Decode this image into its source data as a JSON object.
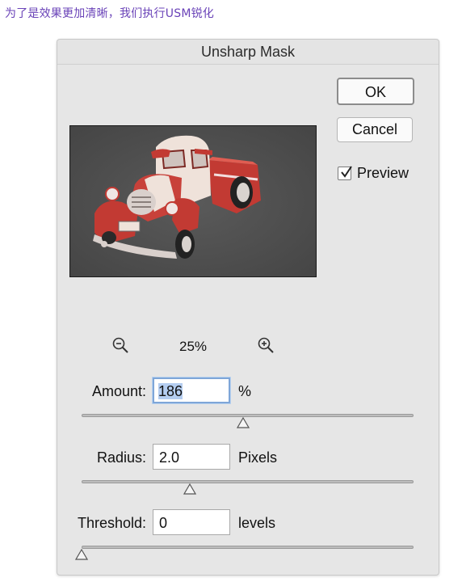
{
  "caption": "为了是效果更加清晰，我们执行USM锐化",
  "dialog": {
    "title": "Unsharp Mask",
    "ok_label": "OK",
    "cancel_label": "Cancel",
    "preview_label": "Preview",
    "preview_checked": true,
    "zoom_level": "25%",
    "amount": {
      "label": "Amount:",
      "value": "186",
      "unit": "%",
      "slider_min": 1,
      "slider_max": 500
    },
    "radius": {
      "label": "Radius:",
      "value": "2.0",
      "unit": "Pixels",
      "slider_min": 0.1,
      "slider_max": 1000
    },
    "threshold": {
      "label": "Threshold:",
      "value": "0",
      "unit": "levels",
      "slider_min": 0,
      "slider_max": 255
    }
  }
}
